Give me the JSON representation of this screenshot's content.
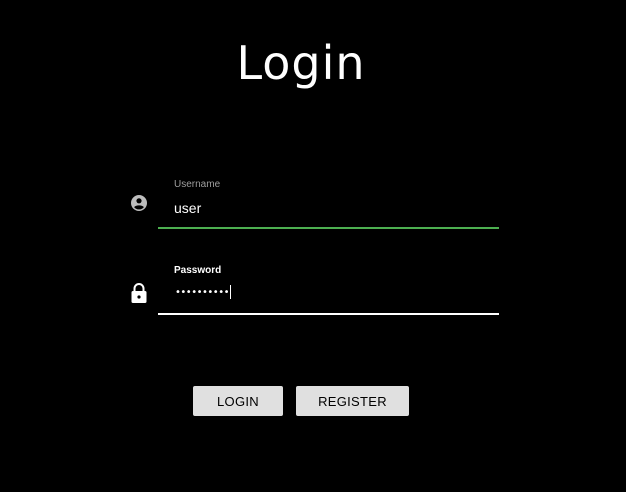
{
  "page": {
    "title": "Login"
  },
  "form": {
    "username": {
      "label": "Username",
      "value": "user",
      "icon": "account-circle-icon"
    },
    "password": {
      "label": "Password",
      "masked_value": "••••••••••",
      "icon": "lock-icon"
    }
  },
  "buttons": {
    "login_label": "LOGIN",
    "register_label": "REGISTER"
  },
  "colors": {
    "background": "#000000",
    "focus_underline": "#4caf50",
    "button_bg": "#e0e0e0"
  }
}
